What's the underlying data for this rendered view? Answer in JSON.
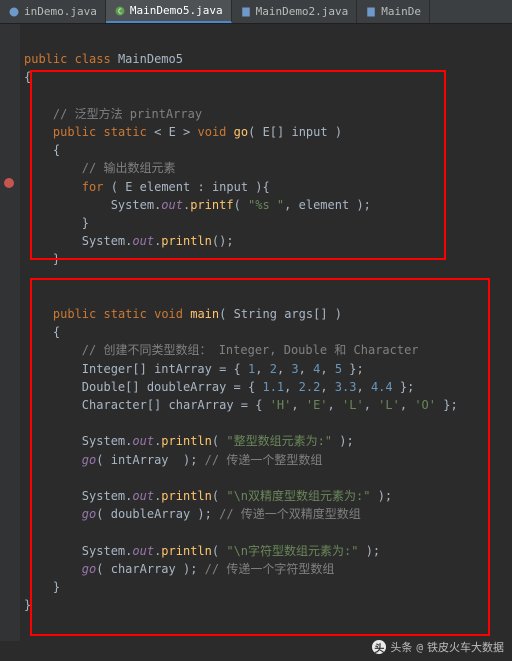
{
  "tabs": [
    {
      "label": "inDemo.java",
      "active": false
    },
    {
      "label": "MainDemo5.java",
      "active": true
    },
    {
      "label": "MainDemo2.java",
      "active": false
    },
    {
      "label": "MainDe",
      "active": false
    }
  ],
  "code": {
    "l1": {
      "kw1": "public",
      "kw2": "class",
      "name": "MainDemo5"
    },
    "l2": "{",
    "l3": "",
    "l4": {
      "cmt": "// 泛型方法 printArray"
    },
    "l5": {
      "kw1": "public",
      "kw2": "static",
      "open": "<",
      "gen": "E",
      "close": ">",
      "kw3": "void",
      "mth": "go",
      "p": "(",
      "ty": "E[]",
      "arg": "input",
      "rp": ")"
    },
    "l6": "{",
    "l7": {
      "cmt": "// 输出数组元素"
    },
    "l8": {
      "kw": "for",
      "p": "(",
      "ty": "E",
      "var": "element",
      "colon": ":",
      "it": "input",
      "rp": "){"
    },
    "l9": {
      "cls": "System.",
      "fld": "out",
      "dot": ".",
      "mth": "printf",
      "p": "(",
      "s": "\"%s \"",
      "c": ",",
      "arg": "element",
      "rp": ");"
    },
    "l10": "}",
    "l11": {
      "cls": "System.",
      "fld": "out",
      "dot": ".",
      "mth": "println",
      "p": "();"
    },
    "l12": "}",
    "l13": "",
    "l14": "",
    "l15": {
      "kw1": "public",
      "kw2": "static",
      "kw3": "void",
      "mth": "main",
      "p": "(",
      "ty": "String",
      "arg": "args[]",
      "rp": ")"
    },
    "l16": "{",
    "l17": {
      "cmt": "// 创建不同类型数组： Integer, Double 和 Character"
    },
    "l18": {
      "ty": "Integer[]",
      "var": "intArray",
      "eq": "= {",
      "v1": "1",
      "c1": ",",
      "v2": "2",
      "c2": ",",
      "v3": "3",
      "c3": ",",
      "v4": "4",
      "c4": ",",
      "v5": "5",
      "end": "};"
    },
    "l19": {
      "ty": "Double[]",
      "var": "doubleArray",
      "eq": "= {",
      "v1": "1.1",
      "c1": ",",
      "v2": "2.2",
      "c2": ",",
      "v3": "3.3",
      "c3": ",",
      "v4": "4.4",
      "end": "};"
    },
    "l20": {
      "ty": "Character[]",
      "var": "charArray",
      "eq": "= {",
      "v1": "'H'",
      "c1": ",",
      "v2": "'E'",
      "c2": ",",
      "v3": "'L'",
      "c3": ",",
      "v4": "'L'",
      "c4": ",",
      "v5": "'O'",
      "end": "};"
    },
    "l21": "",
    "l22": {
      "cls": "System.",
      "fld": "out",
      "dot": ".",
      "mth": "println",
      "p": "(",
      "s": "\"整型数组元素为:\"",
      "rp": ");"
    },
    "l23": {
      "mth": "go",
      "p": "(",
      "arg": "intArray  ",
      "rp": ");",
      "cmt": " // 传递一个整型数组"
    },
    "l24": "",
    "l25": {
      "cls": "System.",
      "fld": "out",
      "dot": ".",
      "mth": "println",
      "p": "(",
      "s": "\"\\n双精度型数组元素为:\"",
      "rp": ");"
    },
    "l26": {
      "mth": "go",
      "p": "(",
      "arg": "doubleArray ",
      "rp": ");",
      "cmt": " // 传递一个双精度型数组"
    },
    "l27": "",
    "l28": {
      "cls": "System.",
      "fld": "out",
      "dot": ".",
      "mth": "println",
      "p": "(",
      "s": "\"\\n字符型数组元素为:\"",
      "rp": ");"
    },
    "l29": {
      "mth": "go",
      "p": "(",
      "arg": "charArray ",
      "rp": ");",
      "cmt": " // 传递一个字符型数组"
    },
    "l30": "}",
    "l31": "}"
  },
  "watermark": {
    "prefix": "头条",
    "at": "@",
    "name": "铁皮火车大数据"
  }
}
